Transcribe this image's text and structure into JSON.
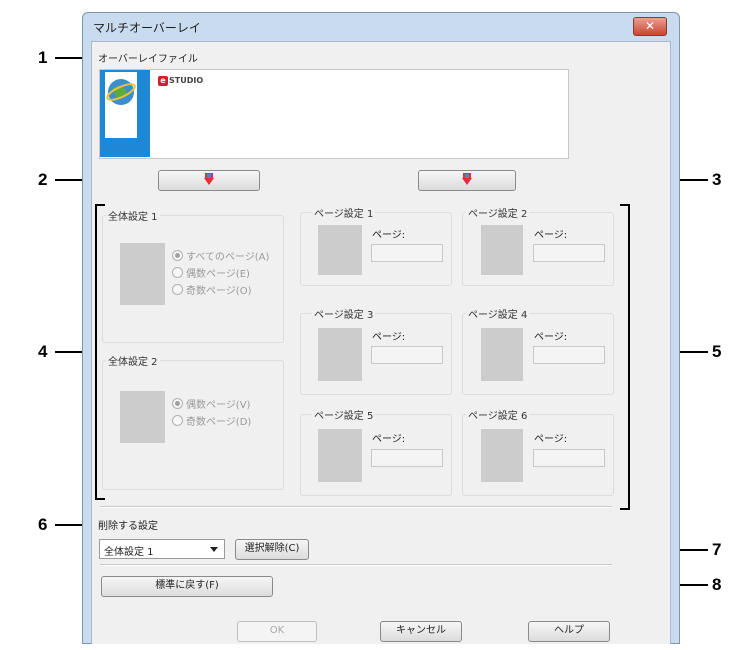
{
  "window": {
    "title": "マルチオーバーレイ",
    "close_glyph": "✕"
  },
  "overlay_file": {
    "label": "オーバーレイファイル",
    "logo_text": "STUDIO",
    "logo_prefix": "e"
  },
  "global_settings": [
    {
      "title": "全体設定 1",
      "options": [
        "すべてのページ(A)",
        "偶数ページ(E)",
        "奇数ページ(O)"
      ],
      "selected": 0
    },
    {
      "title": "全体設定 2",
      "options": [
        "偶数ページ(V)",
        "奇数ページ(D)"
      ],
      "selected": 0
    }
  ],
  "page_settings": [
    {
      "title": "ページ設定 1",
      "page_label": "ページ:"
    },
    {
      "title": "ページ設定 2",
      "page_label": "ページ:"
    },
    {
      "title": "ページ設定 3",
      "page_label": "ページ:"
    },
    {
      "title": "ページ設定 4",
      "page_label": "ページ:"
    },
    {
      "title": "ページ設定 5",
      "page_label": "ページ:"
    },
    {
      "title": "ページ設定 6",
      "page_label": "ページ:"
    }
  ],
  "delete": {
    "label": "削除する設定",
    "selected_value": "全体設定 1",
    "deselect_button": "選択解除(C)"
  },
  "reset_button": "標準に戻す(F)",
  "footer": {
    "ok": "OK",
    "cancel": "キャンセル",
    "help": "ヘルプ"
  },
  "callouts": [
    "1",
    "2",
    "3",
    "4",
    "5",
    "6",
    "7",
    "8"
  ],
  "colors": {
    "accent": "#1e88d6",
    "arrow": "#e03030",
    "frame": "#c9dcef"
  }
}
